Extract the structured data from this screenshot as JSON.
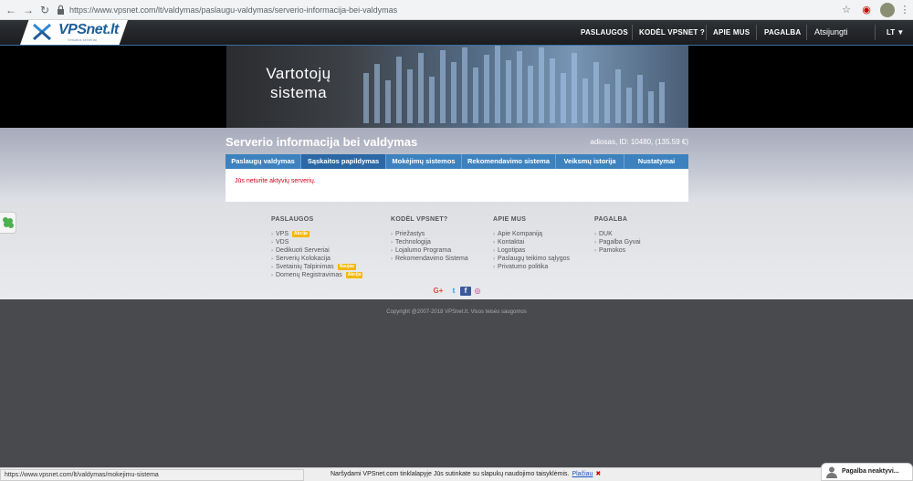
{
  "browser": {
    "url": "https://www.vpsnet.com/lt/valdymas/paslaugu-valdymas/serverio-informacija-bei-valdymas"
  },
  "header": {
    "logo_text": "VPSnet.lt",
    "logo_subtitle": "Virtualus serveriai",
    "nav": [
      "PASLAUGOS",
      "KODĖL VPSNET ?",
      "APIE MUS",
      "PAGALBA"
    ],
    "login": "Atsijungti",
    "language": "LT ▼"
  },
  "banner": {
    "line1": "Vartotojų",
    "line2": "sistema"
  },
  "page": {
    "title": "Serverio informacija bei valdymas",
    "account_info": "adiosas, ID: 10480, (135.59 €)",
    "tabs": [
      {
        "label": "Paslaugų valdymas",
        "active": false
      },
      {
        "label": "Sąskaitos papildymas",
        "active": true
      },
      {
        "label": "Mokėjimų sistemos",
        "active": false
      },
      {
        "label": "Rekomendavimo sistema",
        "active": false
      },
      {
        "label": "Veiksmų istorija",
        "active": false
      },
      {
        "label": "Nustatymai",
        "active": false
      }
    ],
    "message": "Jūs neturite aktyvių serverių."
  },
  "footer": {
    "columns": [
      {
        "heading": "PASLAUGOS",
        "items": [
          {
            "label": "VPS",
            "badge": "Akcija"
          },
          {
            "label": "VDS",
            "badge": ""
          },
          {
            "label": "Dedikuoti Serveriai",
            "badge": ""
          },
          {
            "label": "Serverių Kolokacija",
            "badge": ""
          },
          {
            "label": "Svetainių Talpinimas",
            "badge": "Naujas"
          },
          {
            "label": "Domenų Registravimas",
            "badge": "Akcija"
          }
        ]
      },
      {
        "heading": "KODĖL VPSNET?",
        "items": [
          {
            "label": "Priežastys",
            "badge": ""
          },
          {
            "label": "Technologija",
            "badge": ""
          },
          {
            "label": "Lojalumo Programa",
            "badge": ""
          },
          {
            "label": "Rekomendavimo Sistema",
            "badge": ""
          }
        ]
      },
      {
        "heading": "APIE MUS",
        "items": [
          {
            "label": "Apie Kompaniją",
            "badge": ""
          },
          {
            "label": "Kontaktai",
            "badge": ""
          },
          {
            "label": "Logotipas",
            "badge": ""
          },
          {
            "label": "Paslaugų teikimo sąlygos",
            "badge": ""
          },
          {
            "label": "Privatumo politika",
            "badge": ""
          }
        ]
      },
      {
        "heading": "PAGALBA",
        "items": [
          {
            "label": "DUK",
            "badge": ""
          },
          {
            "label": "Pagalba Gyvai",
            "badge": ""
          },
          {
            "label": "Pamokos",
            "badge": ""
          }
        ]
      }
    ],
    "social": {
      "google": "G+",
      "twitter": "t",
      "facebook": "f",
      "instagram": "◎"
    },
    "copyright": "Copyright @2007-2018 VPSnet.lt. Visos teisės saugomos"
  },
  "status_bar": {
    "url": "https://www.vpsnet.com/lt/valdymas/mokejimu-sistema"
  },
  "cookie_notice": {
    "text": "Naršydami VPSnet.com tinklalapyje Jūs sutinkate su slapukų naudojimo taisyklėmis.",
    "link": "Plačiau",
    "close": "✖"
  },
  "help_widget": {
    "label": "Pagalba neaktyvi..."
  },
  "colors": {
    "brand_blue": "#1f5e99",
    "tab_blue": "#3d82bf",
    "error_red": "#d0021b",
    "badge_yellow": "#f7b500"
  }
}
